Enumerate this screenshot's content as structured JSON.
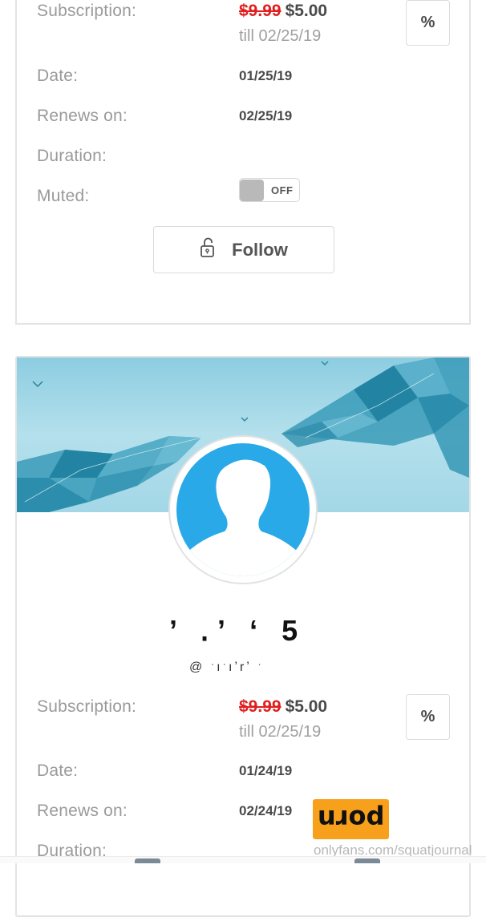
{
  "card1": {
    "subscription_label": "Subscription:",
    "price_old": "$9.99",
    "price_new": "$5.00",
    "till": "till 02/25/19",
    "date_label": "Date:",
    "date_value": "01/25/19",
    "renews_label": "Renews on:",
    "renews_value": "02/25/19",
    "duration_label": "Duration:",
    "muted_label": "Muted:",
    "muted_toggle": "OFF",
    "follow_label": "Follow",
    "discount_label": "%"
  },
  "card2": {
    "name": "’ ․ʼ ‘  5",
    "handle": "@ ˑıˑıʼrʼ ˑ",
    "subscription_label": "Subscription:",
    "price_old": "$9.99",
    "price_new": "$5.00",
    "till": "till 02/25/19",
    "date_label": "Date:",
    "date_value": "01/24/19",
    "renews_label": "Renews on:",
    "renews_value": "02/24/19",
    "duration_label": "Duration:",
    "discount_label": "%"
  },
  "watermark": {
    "badge": "porn",
    "url": "onlyfans.com/squatjournal"
  },
  "colors": {
    "price_old": "#e02020",
    "avatar_bg": "#29a9e8",
    "cover_bg": "#a8dbe9",
    "watermark_badge": "#f7a01b"
  },
  "icons": {
    "follow": "unlock-icon",
    "avatar": "person-silhouette-icon"
  }
}
